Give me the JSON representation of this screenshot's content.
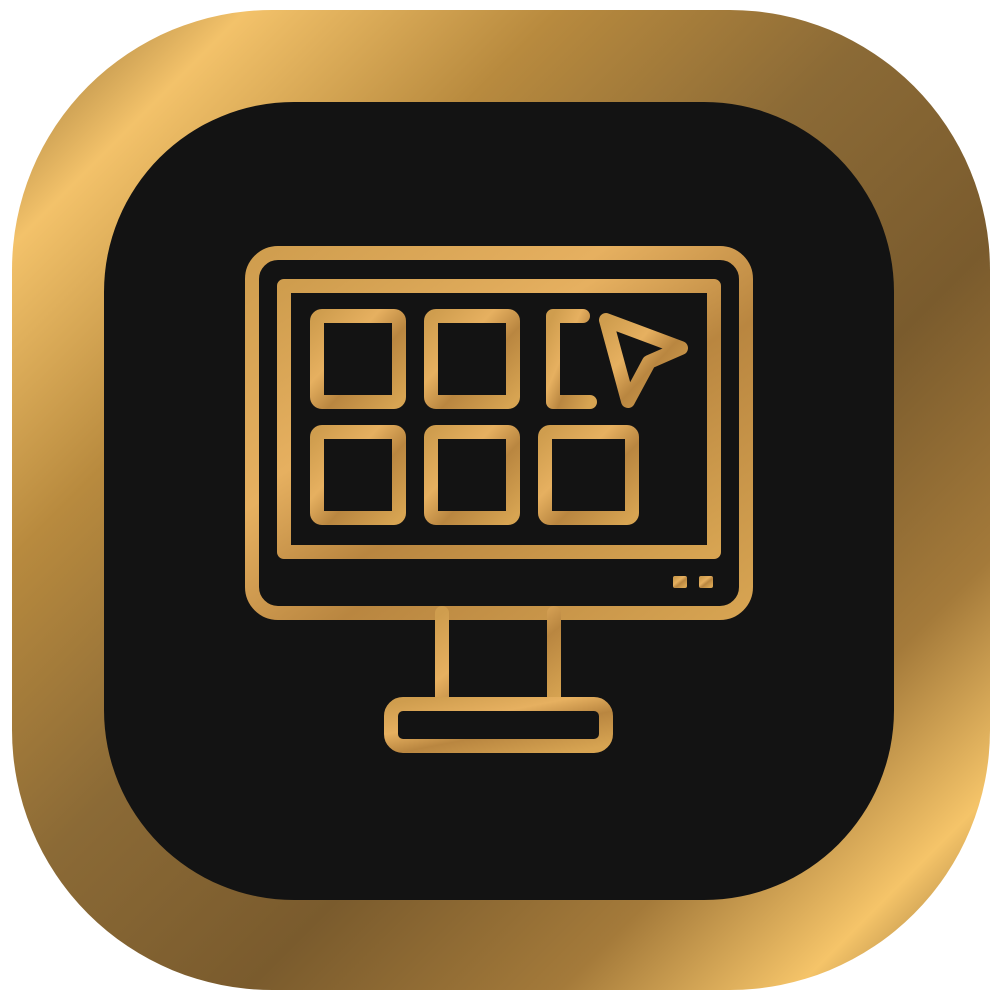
{
  "icon": {
    "name": "computer-monitor-grid-cursor-icon",
    "colors": {
      "background": "#ffffff",
      "tile_inner": "#131313",
      "gold_light": "#f6c467",
      "gold_mid": "#c9953f",
      "gold_dark": "#8a6530",
      "gold_deep": "#6e5126"
    }
  }
}
